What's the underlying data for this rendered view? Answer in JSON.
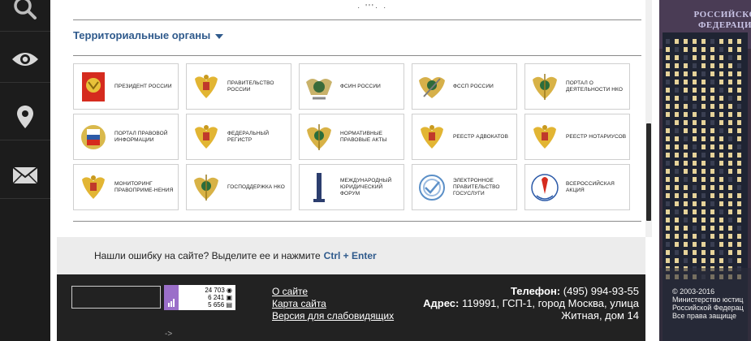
{
  "rail": {
    "items": [
      {
        "icon": "search-icon"
      },
      {
        "icon": "eye-icon"
      },
      {
        "icon": "location-pin-icon"
      },
      {
        "icon": "mail-icon"
      }
    ]
  },
  "main": {
    "top_stub": "· '''· ·",
    "section_title": "Территориальные органы",
    "tiles": [
      {
        "label": "Президент России",
        "icon": "flag-emblem-icon"
      },
      {
        "label": "Правительство России",
        "icon": "eagle-emblem-icon"
      },
      {
        "label": "ФСИН России",
        "icon": "fsin-emblem-icon"
      },
      {
        "label": "ФССП России",
        "icon": "fssp-emblem-icon"
      },
      {
        "label": "Портал о деятельности НКО",
        "icon": "justice-emblem-icon"
      },
      {
        "label": "Портал правовой информации",
        "icon": "legal-info-emblem-icon"
      },
      {
        "label": "Федеральный регистр",
        "icon": "eagle-emblem-icon"
      },
      {
        "label": "Нормативные правовые акты",
        "icon": "justice-emblem-icon"
      },
      {
        "label": "Реестр адвокатов",
        "icon": "eagle-emblem-icon"
      },
      {
        "label": "Реестр нотариусов",
        "icon": "eagle-emblem-icon"
      },
      {
        "label": "Мониторинг правоприме-нения",
        "icon": "eagle-emblem-icon"
      },
      {
        "label": "Господдержка НКО",
        "icon": "justice-emblem-icon"
      },
      {
        "label": "Международный юридический форум",
        "icon": "monument-icon"
      },
      {
        "label": "Электронное правительство Госуслуги",
        "icon": "gosuslugi-icon"
      },
      {
        "label": "Всероссийская акция",
        "icon": "stop-hiv-icon"
      }
    ]
  },
  "notice": {
    "text": "Нашли ошибку на сайте? Выделите ее и нажмите",
    "shortcut": "Ctrl + Enter"
  },
  "footer": {
    "counter": [
      "24 703",
      "6 241",
      "5 656"
    ],
    "links": [
      "О сайте",
      "Карта сайта",
      "Версия для слабовидящих"
    ],
    "phone_label": "Телефон:",
    "phone": "(495) 994-93-55",
    "address_label": "Адрес:",
    "address_line1": "119991, ГСП-1, город Москва, улица",
    "address_line2": "Житная, дом 14",
    "arrow": "->"
  },
  "photo": {
    "title_line1": "РОССИЙСКО",
    "title_line2": "ФЕДЕРАЦИ",
    "copyright": [
      "© 2003-2016",
      "Министерство юстиц",
      "Российской Федерац",
      "Все права защище"
    ]
  },
  "colors": {
    "accent": "#2f5a8c",
    "rail": "#1c1c1c",
    "footer": "#222222",
    "notice": "#ececec"
  }
}
